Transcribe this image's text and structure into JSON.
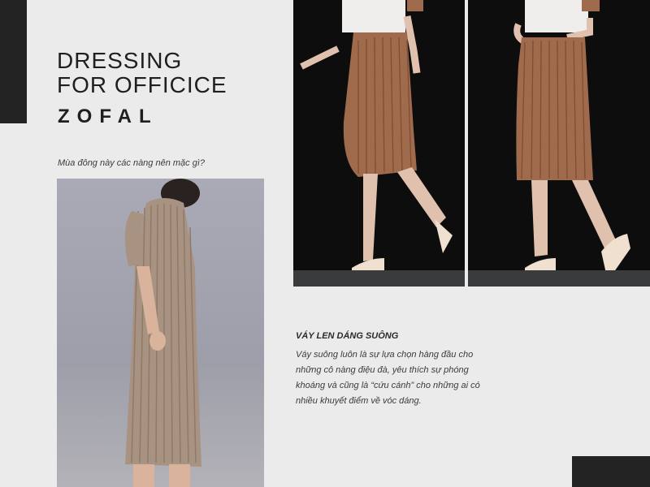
{
  "header": {
    "title_line1": "DRESSING",
    "title_line2": "FOR OFFICICE",
    "brand": "ZOFAL",
    "question": "Mùa đông này các nàng nên mặc gì?"
  },
  "feature": {
    "title": "VÁY LEN DÁNG SUÔNG",
    "lines": [
      "Váy suông luôn là sự lựa chọn hàng đầu cho",
      "những cô nàng điệu đà, yêu thích sự phóng",
      "khoáng và cũng là “cứu cánh” cho những ai có",
      "nhiều khuyết điểm về vóc dáng."
    ]
  },
  "colors": {
    "background": "#ebebeb",
    "accent_dark": "#232323",
    "knit_brown": "#a06a4c",
    "knit_beige": "#a89382"
  }
}
